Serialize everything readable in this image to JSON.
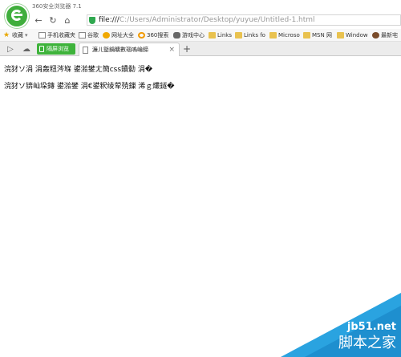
{
  "app": {
    "title": "360安全浏览器 7.1"
  },
  "address": {
    "scheme": "file:///",
    "path": "C:/Users/Administrator/Desktop/yuyue/Untitled-1.html"
  },
  "bookmarks": {
    "favorites": "收藏",
    "items": [
      {
        "label": "手机收藏夹",
        "icon": "page-icon"
      },
      {
        "label": "谷歌",
        "icon": "page-icon"
      },
      {
        "label": "网址大全",
        "icon": "round-icon"
      },
      {
        "label": "360搜索",
        "icon": "360-icon"
      },
      {
        "label": "游戏中心",
        "icon": "game-icon"
      },
      {
        "label": "Links",
        "icon": "folder-icon"
      },
      {
        "label": "Links fo",
        "icon": "folder-icon"
      },
      {
        "label": "Microso",
        "icon": "folder-icon"
      },
      {
        "label": "MSN 网",
        "icon": "folder-icon"
      },
      {
        "label": "Window",
        "icon": "folder-icon"
      },
      {
        "label": "最新宅",
        "icon": "avatar-icon"
      }
    ]
  },
  "tabs": {
    "pill_label": "隔屏浏览",
    "active_tab": "濂ㄦ墍鍋曠數瑙嗚崘鍗",
    "new_tab": "+"
  },
  "content": {
    "line1": "浣犲ソ涓   涓轰粈涔堢    鍙湁鐢ㄤ簡css鐨勬   涓�",
    "line2": "浣犲ソ锛屾垜鏄    鍙湁鐢    涓€鍙粎绫荤殑鏁   浠ｇ爜鐩�"
  },
  "watermark": {
    "site": "jb51.net",
    "brand": "脚本之家"
  },
  "colors": {
    "accent_green": "#3eb33b",
    "watermark_blue": "#2aa3e0"
  }
}
